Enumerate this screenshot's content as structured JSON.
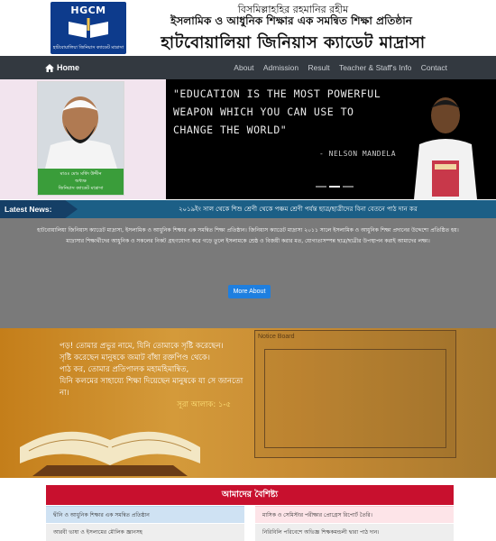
{
  "header": {
    "logo_abbr": "HGCM",
    "logo_tagline": "হাটবোয়ালিয়া জিনিয়াস ক্যাডেট মাদ্রাসা",
    "bismillah": "বিসমিল্লাহহির রহমানির রহীম",
    "subtitle": "ইসলামিক ও আধুনিক শিক্ষার এক সমন্বিত শিক্ষা প্রতিষ্ঠান",
    "title": "হাটবোয়ালিয়া জিনিয়াস ক্যাডেট মাদ্রাসা"
  },
  "nav": {
    "home": "Home",
    "links": [
      "About",
      "Admission",
      "Result",
      "Teacher & Staff's Info",
      "Contact"
    ]
  },
  "profile": {
    "name": "মাওঃ মোঃ মর্ষিদ উদ্দীন",
    "role": "অধ্যক্ষ",
    "org": "জিনিয়াস ক্যাডেট মাদ্রাসা"
  },
  "slider": {
    "quote_lines": [
      "\"EDUCATION IS THE MOST POWERFUL",
      "WEAPON WHICH YOU CAN USE TO",
      "CHANGE THE WORLD\""
    ],
    "author": "- NELSON MANDELA"
  },
  "news": {
    "label": "Latest News:",
    "text": "২০১৯ইং সাল থেকে শিশু শ্রেণী থেকে পঞ্চম শ্রেণী পর্যন্ত ছাত্র/ছাত্রীদের বিনা বেতনে পাঠ দান কর"
  },
  "about": {
    "text": "হাটবোয়ালিয়া জিনিয়াস ক্যাডেট মাদ্রাসা, ইসলামিক ও আধুনিক শিক্ষার এক সমন্বিত শিক্ষা প্রতিষ্ঠান। জিনিয়াস ক্যাডেট মাদ্রাসা ২০১১ সালে ইসলামিক ও আধুনিক শিক্ষা প্রদানের উদ্দেশ্যে প্রতিষ্ঠিত হয়। মাদ্রাসার শিক্ষার্থীদের আধুনিক ও সকলের নিকট গ্রহণযোগ্য করে গড়ে তুলে ইসলামকে শ্রেষ্ঠ ও বিজয়ী করার মত, যোগ্যতাসম্পন্ন ছাত্র/ছাত্রীর উপস্থাপন করাই আমাদের লক্ষ্য।",
    "button": "More About"
  },
  "verse": {
    "lines": [
      "পড়! তোমার প্রভুর নামে, যিনি তোমাকে সৃষ্টি করেছেন।",
      "সৃষ্টি করেছেন মানুষকে জমাট বাঁধা রক্তপিণ্ড থেকে।",
      "পাঠ কর, তোমার প্রতিপালক মহামহিমান্বিত,",
      "যিনি কলমের সাহায্যে শিক্ষা দিয়েছেন মানুষকে যা সে জানতো না।"
    ],
    "reference": "সূরা আলাক: ১-৫"
  },
  "notice": {
    "title": "Notice Board"
  },
  "features": {
    "title": "আমাদের বৈশিষ্ট্য",
    "items": [
      "দ্বীনি ও আধুনিক শিক্ষার এক সমন্বিত প্রতিষ্ঠান",
      "মাসিক ও সেমিস্টার পরীক্ষার প্রোগ্রেস রিপোর্ট তৈরি।",
      "আরবী ভাষা ও ইসলামের মৌলিক জ্ঞানসহ",
      "নিরিবিলি পরিবেশে অভিজ্ঞ শিক্ষকমন্ডলী দ্বারা পাঠ দান।"
    ]
  },
  "colors": {
    "navbar": "#333940",
    "news_bar": "#1c5f86",
    "features_header": "#c8102e",
    "about_button": "#1e7fe0"
  }
}
